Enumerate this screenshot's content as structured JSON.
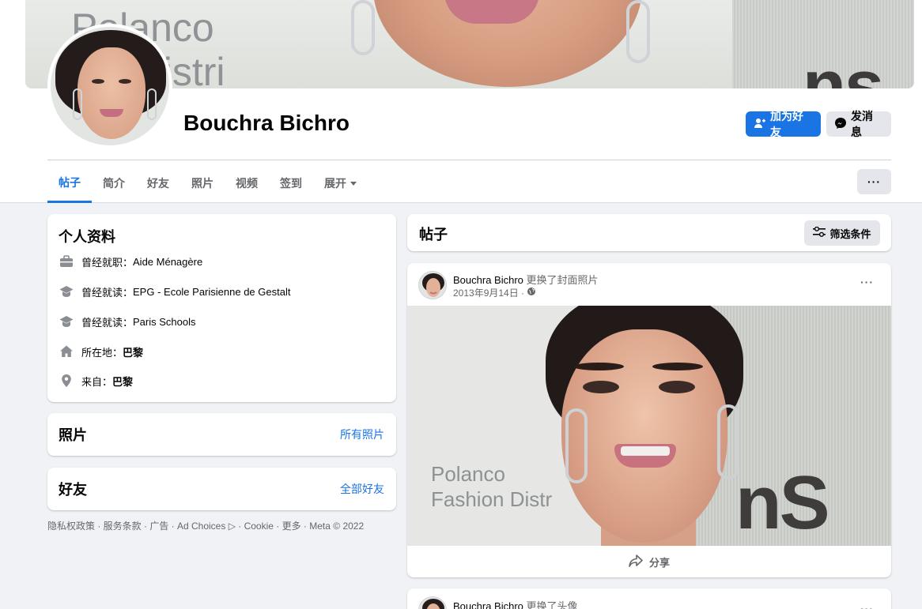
{
  "profile": {
    "name": "Bouchra Bichro",
    "add_friend_label": "加为好友",
    "message_label": "发消息"
  },
  "tabs": [
    {
      "label": "帖子",
      "active": true
    },
    {
      "label": "简介"
    },
    {
      "label": "好友"
    },
    {
      "label": "照片"
    },
    {
      "label": "视频"
    },
    {
      "label": "签到"
    },
    {
      "label": "展开"
    }
  ],
  "more_label": "···",
  "intro": {
    "title": "个人资料",
    "items": [
      {
        "icon": "briefcase-icon",
        "prefix": "曾经就职：",
        "value": "Aide Ménagère"
      },
      {
        "icon": "graduation-cap-icon",
        "prefix": "曾经就读：",
        "value": "EPG - Ecole Parisienne de Gestalt"
      },
      {
        "icon": "graduation-cap-icon",
        "prefix": "曾经就读：",
        "value": "Paris Schools"
      },
      {
        "icon": "home-icon",
        "prefix": "所在地：",
        "value": "巴黎"
      },
      {
        "icon": "location-pin-icon",
        "prefix": "来自：",
        "value": "巴黎"
      }
    ]
  },
  "photos": {
    "title": "照片",
    "link": "所有照片"
  },
  "friends": {
    "title": "好友",
    "link": "全部好友"
  },
  "footer": "隐私权政策 · 服务条款 · 广告 · Ad Choices ▷ · Cookie · 更多 · Meta © 2022",
  "posts_header": {
    "title": "帖子",
    "filter_label": "筛选条件"
  },
  "post1": {
    "author": "Bouchra Bichro",
    "action": " 更换了封面照片",
    "date": "2013年9月14日 ·",
    "image_text_1": "Polanco",
    "image_text_2": "Fashion Distr",
    "image_text_3": "nS",
    "share_label": "分享"
  },
  "post2": {
    "author": "Bouchra Bichro",
    "action": " 更换了头像"
  },
  "cover": {
    "text_1": "Polanco",
    "text_2": "ion Distri",
    "text_3": "ns"
  },
  "colors": {
    "accent": "#1b74e4",
    "background": "#f0f2f5"
  }
}
